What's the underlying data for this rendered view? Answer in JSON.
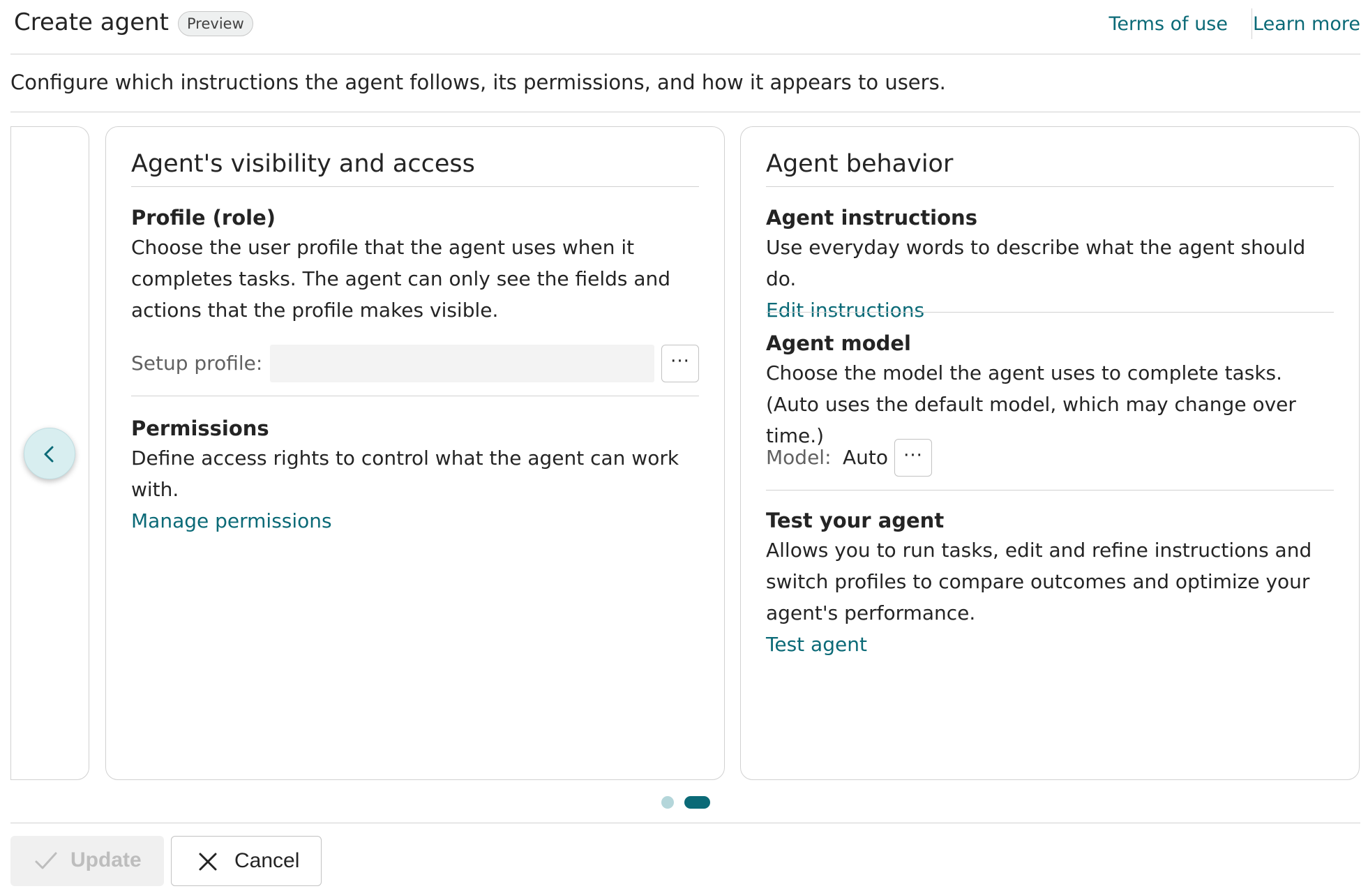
{
  "header": {
    "title": "Create agent",
    "badge": "Preview",
    "terms_link": "Terms of use",
    "learn_link": "Learn more"
  },
  "description": "Configure which instructions the agent follows, its permissions, and how it appears to users.",
  "visibility_card": {
    "title": "Agent's visibility and access",
    "profile": {
      "title": "Profile (role)",
      "text": "Choose the user profile that the agent uses when it completes tasks. The agent can only see the fields and actions that the profile makes visible.",
      "setup_label": "Setup profile:",
      "setup_value": "",
      "more_label": "···"
    },
    "permissions": {
      "title": "Permissions",
      "text": "Define access rights to control what the agent can work with.",
      "link": "Manage permissions"
    }
  },
  "behavior_card": {
    "title": "Agent behavior",
    "instructions": {
      "title": "Agent instructions",
      "text": "Use everyday words to describe what the agent should do.",
      "link": "Edit instructions"
    },
    "model": {
      "title": "Agent model",
      "text": "Choose the model the agent uses to complete tasks. (Auto uses the default model, which may change over time.)",
      "label": "Model:",
      "value": "Auto",
      "more_label": "···"
    },
    "test": {
      "title": "Test your agent",
      "text": "Allows you to run tasks, edit and refine instructions and switch profiles to compare outcomes and optimize your agent's performance.",
      "link": "Test agent"
    }
  },
  "pager": {
    "total": 2,
    "active": 2
  },
  "footer": {
    "update_label": "Update",
    "cancel_label": "Cancel"
  },
  "icons": {
    "prev": "chevron-left-icon",
    "update": "checkmark-icon",
    "cancel": "dismiss-icon"
  },
  "colors": {
    "accent": "#0b6a77",
    "accent_light": "#d8eef0",
    "border": "#d1d1d1",
    "text": "#242424",
    "muted": "#616161"
  }
}
